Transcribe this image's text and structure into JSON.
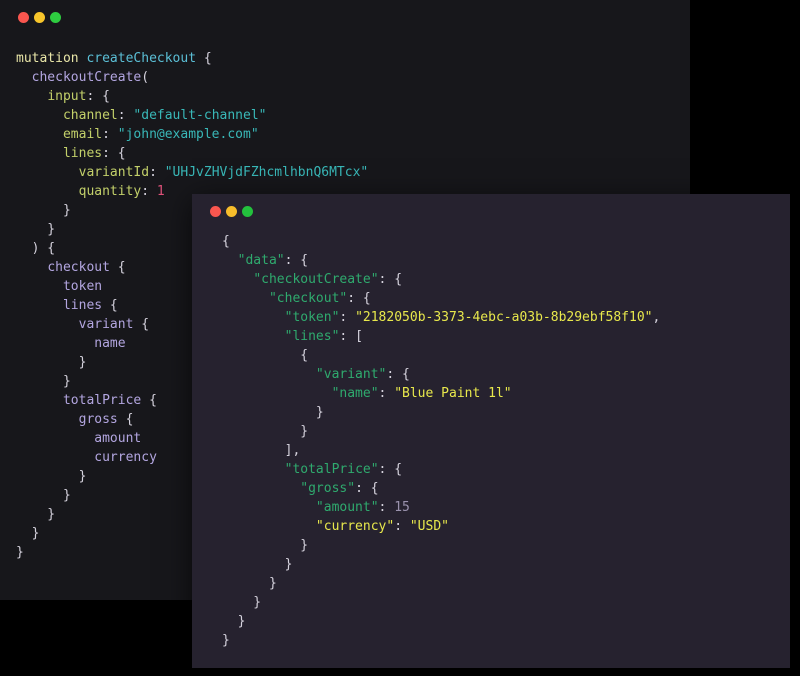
{
  "window_controls": {
    "close_label": "close",
    "minimize_label": "minimize",
    "maximize_label": "maximize",
    "colors": {
      "close": "#f9564f",
      "minimize": "#f7c52b",
      "maximize": "#2ecc40"
    }
  },
  "query_panel": {
    "background": "#17171b",
    "language": "graphql",
    "lines": [
      [
        {
          "t": "mutation",
          "c": "t-kw"
        },
        {
          "t": " ",
          "c": "t-punc"
        },
        {
          "t": "createCheckout",
          "c": "t-opname"
        },
        {
          "t": " {",
          "c": "t-punc"
        }
      ],
      [
        {
          "t": "  ",
          "c": "t-punc"
        },
        {
          "t": "checkoutCreate",
          "c": "t-field"
        },
        {
          "t": "(",
          "c": "t-punc"
        }
      ],
      [
        {
          "t": "    ",
          "c": "t-punc"
        },
        {
          "t": "input",
          "c": "t-arg"
        },
        {
          "t": ": {",
          "c": "t-punc"
        }
      ],
      [
        {
          "t": "      ",
          "c": "t-punc"
        },
        {
          "t": "channel",
          "c": "t-arg"
        },
        {
          "t": ": ",
          "c": "t-punc"
        },
        {
          "t": "\"default-channel\"",
          "c": "t-str"
        }
      ],
      [
        {
          "t": "      ",
          "c": "t-punc"
        },
        {
          "t": "email",
          "c": "t-arg"
        },
        {
          "t": ": ",
          "c": "t-punc"
        },
        {
          "t": "\"john@example.com\"",
          "c": "t-str"
        }
      ],
      [
        {
          "t": "      ",
          "c": "t-punc"
        },
        {
          "t": "lines",
          "c": "t-arg"
        },
        {
          "t": ": {",
          "c": "t-punc"
        }
      ],
      [
        {
          "t": "        ",
          "c": "t-punc"
        },
        {
          "t": "variantId",
          "c": "t-arg"
        },
        {
          "t": ": ",
          "c": "t-punc"
        },
        {
          "t": "\"UHJvZHVjdFZhcmlhbnQ6MTcx\"",
          "c": "t-str"
        }
      ],
      [
        {
          "t": "        ",
          "c": "t-punc"
        },
        {
          "t": "quantity",
          "c": "t-arg"
        },
        {
          "t": ": ",
          "c": "t-punc"
        },
        {
          "t": "1",
          "c": "t-num"
        }
      ],
      [
        {
          "t": "      }",
          "c": "t-punc"
        }
      ],
      [
        {
          "t": "    }",
          "c": "t-punc"
        }
      ],
      [
        {
          "t": "  ) {",
          "c": "t-punc"
        }
      ],
      [
        {
          "t": "    ",
          "c": "t-punc"
        },
        {
          "t": "checkout",
          "c": "t-field"
        },
        {
          "t": " {",
          "c": "t-punc"
        }
      ],
      [
        {
          "t": "      ",
          "c": "t-punc"
        },
        {
          "t": "token",
          "c": "t-field"
        }
      ],
      [
        {
          "t": "      ",
          "c": "t-punc"
        },
        {
          "t": "lines",
          "c": "t-field"
        },
        {
          "t": " {",
          "c": "t-punc"
        }
      ],
      [
        {
          "t": "        ",
          "c": "t-punc"
        },
        {
          "t": "variant",
          "c": "t-field"
        },
        {
          "t": " {",
          "c": "t-punc"
        }
      ],
      [
        {
          "t": "          ",
          "c": "t-punc"
        },
        {
          "t": "name",
          "c": "t-field"
        }
      ],
      [
        {
          "t": "        }",
          "c": "t-punc"
        }
      ],
      [
        {
          "t": "      }",
          "c": "t-punc"
        }
      ],
      [
        {
          "t": "      ",
          "c": "t-punc"
        },
        {
          "t": "totalPrice",
          "c": "t-field"
        },
        {
          "t": " {",
          "c": "t-punc"
        }
      ],
      [
        {
          "t": "        ",
          "c": "t-punc"
        },
        {
          "t": "gross",
          "c": "t-field"
        },
        {
          "t": " {",
          "c": "t-punc"
        }
      ],
      [
        {
          "t": "          ",
          "c": "t-punc"
        },
        {
          "t": "amount",
          "c": "t-field"
        }
      ],
      [
        {
          "t": "          ",
          "c": "t-punc"
        },
        {
          "t": "currency",
          "c": "t-field"
        }
      ],
      [
        {
          "t": "        }",
          "c": "t-punc"
        }
      ],
      [
        {
          "t": "      }",
          "c": "t-punc"
        }
      ],
      [
        {
          "t": "    }",
          "c": "t-punc"
        }
      ],
      [
        {
          "t": "  }",
          "c": "t-punc"
        }
      ],
      [
        {
          "t": "}",
          "c": "t-punc"
        }
      ]
    ]
  },
  "response_panel": {
    "background": "#26222f",
    "language": "json",
    "lines": [
      [
        {
          "t": "{",
          "c": "j-punc"
        }
      ],
      [
        {
          "t": "  ",
          "c": "j-punc"
        },
        {
          "t": "\"data\"",
          "c": "j-key"
        },
        {
          "t": ": {",
          "c": "j-punc"
        }
      ],
      [
        {
          "t": "    ",
          "c": "j-punc"
        },
        {
          "t": "\"checkoutCreate\"",
          "c": "j-key"
        },
        {
          "t": ": {",
          "c": "j-punc"
        }
      ],
      [
        {
          "t": "      ",
          "c": "j-punc"
        },
        {
          "t": "\"checkout\"",
          "c": "j-key"
        },
        {
          "t": ": {",
          "c": "j-punc"
        }
      ],
      [
        {
          "t": "        ",
          "c": "j-punc"
        },
        {
          "t": "\"token\"",
          "c": "j-key"
        },
        {
          "t": ": ",
          "c": "j-punc"
        },
        {
          "t": "\"2182050b-3373-4ebc-a03b-8b29ebf58f10\"",
          "c": "j-str"
        },
        {
          "t": ",",
          "c": "j-punc"
        }
      ],
      [
        {
          "t": "        ",
          "c": "j-punc"
        },
        {
          "t": "\"lines\"",
          "c": "j-key"
        },
        {
          "t": ": [",
          "c": "j-punc"
        }
      ],
      [
        {
          "t": "          {",
          "c": "j-punc"
        }
      ],
      [
        {
          "t": "            ",
          "c": "j-punc"
        },
        {
          "t": "\"variant\"",
          "c": "j-key"
        },
        {
          "t": ": {",
          "c": "j-punc"
        }
      ],
      [
        {
          "t": "              ",
          "c": "j-punc"
        },
        {
          "t": "\"name\"",
          "c": "j-key"
        },
        {
          "t": ": ",
          "c": "j-punc"
        },
        {
          "t": "\"Blue Paint 1l\"",
          "c": "j-str"
        }
      ],
      [
        {
          "t": "            }",
          "c": "j-punc"
        }
      ],
      [
        {
          "t": "          }",
          "c": "j-punc"
        }
      ],
      [
        {
          "t": "        ],",
          "c": "j-punc"
        }
      ],
      [
        {
          "t": "        ",
          "c": "j-punc"
        },
        {
          "t": "\"totalPrice\"",
          "c": "j-key"
        },
        {
          "t": ": {",
          "c": "j-punc"
        }
      ],
      [
        {
          "t": "          ",
          "c": "j-punc"
        },
        {
          "t": "\"gross\"",
          "c": "j-key"
        },
        {
          "t": ": {",
          "c": "j-punc"
        }
      ],
      [
        {
          "t": "            ",
          "c": "j-punc"
        },
        {
          "t": "\"amount\"",
          "c": "j-key"
        },
        {
          "t": ": ",
          "c": "j-punc"
        },
        {
          "t": "15",
          "c": "j-num"
        }
      ],
      [
        {
          "t": "            ",
          "c": "j-punc"
        },
        {
          "t": "\"currency\"",
          "c": "j-keyhl"
        },
        {
          "t": ": ",
          "c": "j-punc"
        },
        {
          "t": "\"USD\"",
          "c": "j-str"
        }
      ],
      [
        {
          "t": "          }",
          "c": "j-punc"
        }
      ],
      [
        {
          "t": "        }",
          "c": "j-punc"
        }
      ],
      [
        {
          "t": "      }",
          "c": "j-punc"
        }
      ],
      [
        {
          "t": "    }",
          "c": "j-punc"
        }
      ],
      [
        {
          "t": "  }",
          "c": "j-punc"
        }
      ],
      [
        {
          "t": "}",
          "c": "j-punc"
        }
      ]
    ]
  }
}
